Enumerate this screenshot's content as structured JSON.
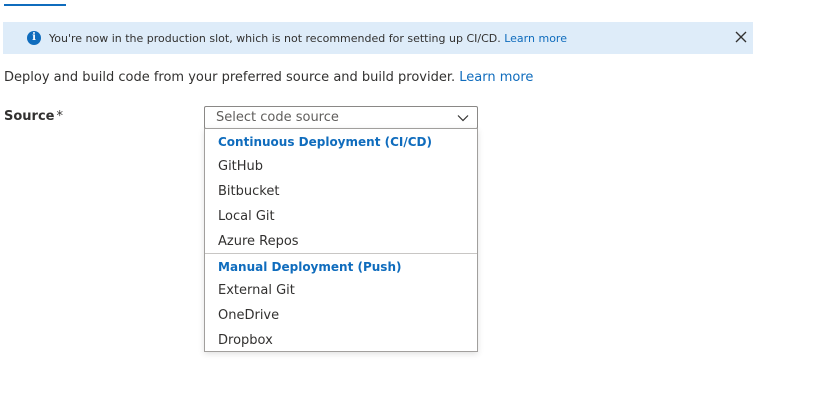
{
  "banner": {
    "message": "You're now in the production slot, which is not recommended for setting up CI/CD.",
    "link": "Learn more",
    "info_icon": "info-icon",
    "close_icon": "close-icon"
  },
  "description": {
    "text": "Deploy and build code from your preferred source and build provider.",
    "link": "Learn more"
  },
  "source": {
    "label": "Source",
    "required_marker": "*",
    "placeholder": "Select code source",
    "chevron_icon": "chevron-down-icon"
  },
  "dropdown": {
    "groups": [
      {
        "header": "Continuous Deployment (CI/CD)",
        "items": [
          "GitHub",
          "Bitbucket",
          "Local Git",
          "Azure Repos"
        ]
      },
      {
        "header": "Manual Deployment (Push)",
        "items": [
          "External Git",
          "OneDrive",
          "Dropbox"
        ]
      }
    ]
  },
  "colors": {
    "accent": "#0f6cbd",
    "banner_bg": "#deecf9"
  }
}
